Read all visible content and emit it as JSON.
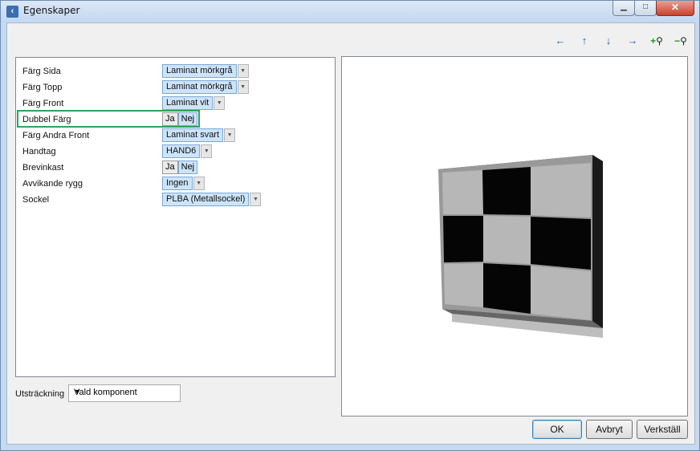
{
  "window": {
    "title": "Egenskaper"
  },
  "toolbar": [
    {
      "icon": "arrow-left-icon",
      "glyph": "←"
    },
    {
      "icon": "arrow-up-icon",
      "glyph": "↑"
    },
    {
      "icon": "arrow-down-icon",
      "glyph": "↓"
    },
    {
      "icon": "arrow-right-icon",
      "glyph": "→"
    },
    {
      "icon": "zoom-in-icon",
      "glyph": "+"
    },
    {
      "icon": "zoom-out-icon",
      "glyph": "−"
    }
  ],
  "properties": [
    {
      "label": "Färg Sida",
      "type": "combo",
      "value": "Laminat mörkgrå"
    },
    {
      "label": "Färg Topp",
      "type": "combo",
      "value": "Laminat mörkgrå"
    },
    {
      "label": "Färg Front",
      "type": "combo",
      "value": "Laminat vit"
    },
    {
      "label": "Dubbel Färg",
      "type": "toggle",
      "options": [
        "Ja",
        "Nej"
      ],
      "selected": "Nej"
    },
    {
      "label": "Färg Andra Front",
      "type": "combo",
      "value": "Laminat svart"
    },
    {
      "label": "Handtag",
      "type": "combo",
      "value": "HAND6"
    },
    {
      "label": "Brevinkast",
      "type": "toggle",
      "options": [
        "Ja",
        "Nej"
      ],
      "selected": "Nej"
    },
    {
      "label": "Avvikande rygg",
      "type": "combo",
      "value": "Ingen"
    },
    {
      "label": "Sockel",
      "type": "combo",
      "value": "PLBA (Metallsockel)"
    }
  ],
  "extent": {
    "label": "Utsträckning",
    "value": "Vald komponent"
  },
  "buttons": {
    "ok": "OK",
    "cancel": "Avbryt",
    "apply": "Verkställ"
  },
  "colors": {
    "highlight": "#2ea35a",
    "selection": "#cde4f9"
  }
}
